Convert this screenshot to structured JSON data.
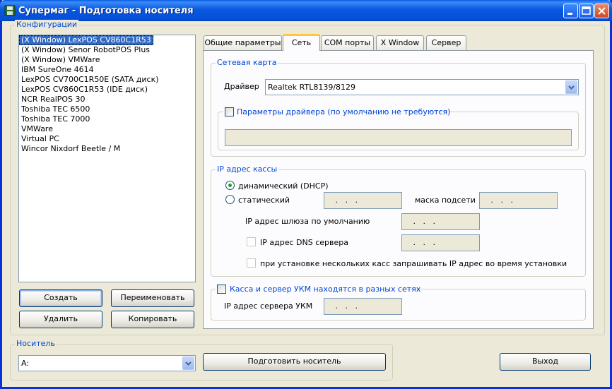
{
  "window": {
    "title": "Супермаг - Подготовка носителя"
  },
  "configs": {
    "group_label": "Конфигурации",
    "items": [
      "(X Window) LexPOS CV860C1R53",
      "(X Window) Senor RobotPOS Plus",
      "(X Window) VMWare",
      "IBM SureOne 4614",
      "LexPOS CV700C1R50E (SATA диск)",
      "LexPOS CV860C1R53 (IDE диск)",
      "NCR RealPOS 30",
      "Toshiba TEC 6500",
      "Toshiba TEC 7000",
      "VMWare",
      "Virtual PC",
      "Wincor Nixdorf Beetle / M"
    ],
    "selected_index": 0,
    "buttons": {
      "create": "Создать",
      "rename": "Переименовать",
      "delete": "Удалить",
      "copy": "Копировать"
    }
  },
  "tabs": [
    "Общие параметры",
    "Сеть",
    "COM порты",
    "X Window",
    "Сервер"
  ],
  "active_tab": "Сеть",
  "network": {
    "nic_group": "Сетевая карта",
    "driver_label": "Драйвер",
    "driver_value": "Realtek RTL8139/8129",
    "driver_params_label": "Параметры драйвера (по умолчанию не требуются)",
    "driver_params_checked": false,
    "driver_params_value": ""
  },
  "ip": {
    "group": "IP адрес кассы",
    "dhcp_label": "динамический (DHCP)",
    "dhcp_selected": true,
    "static_label": "статический",
    "static_ip": " .   .   .",
    "mask_label": "маска подсети",
    "mask_value": " .   .   .",
    "gateway_label": "IP адрес шлюза по умолчанию",
    "gateway_value": " .   .   .",
    "dns_label": "IP адрес DNS сервера",
    "dns_value": " .   .   .",
    "ask_ip_label": "при установке нескольких касс запрашивать IP адрес во время установки"
  },
  "ukm": {
    "label": "Касса и сервер УКМ находятся в разных сетях",
    "checked": false,
    "server_ip_label": "IP адрес сервера УКМ",
    "server_ip_value": " .   .   ."
  },
  "media": {
    "group_label": "Носитель",
    "drive_value": "A:",
    "prepare_button": "Подготовить носитель",
    "exit_button": "Выход"
  },
  "colors": {
    "titlebar": "#0a5ce6",
    "selection": "#316ac5",
    "group_label": "#0046d5",
    "radio_dot": "#21a121"
  }
}
